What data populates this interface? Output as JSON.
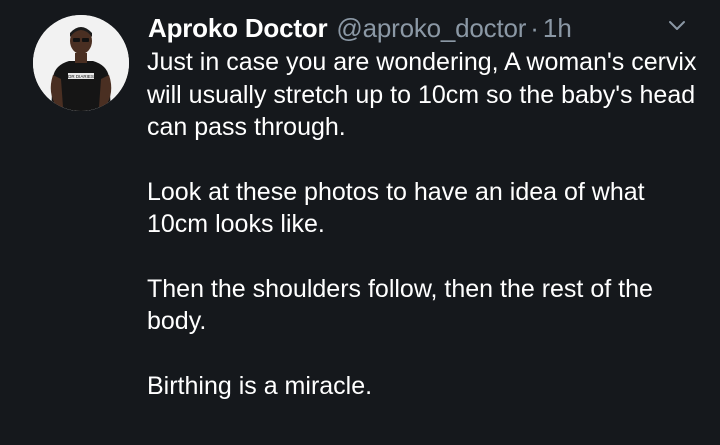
{
  "tweet": {
    "author": {
      "display_name": "Aproko Doctor",
      "handle": "@aproko_doctor",
      "separator": "·",
      "time": "1h",
      "avatar_shirt_text": "DR DIARIES"
    },
    "paragraphs": [
      "Just in case you are wondering, A woman's cervix will usually stretch up to 10cm so the baby's head can pass through.",
      "Look at these photos to have an idea of what 10cm looks like.",
      "Then the shoulders follow, then the rest of the body.",
      "Birthing is a miracle."
    ]
  },
  "colors": {
    "background": "#15181c",
    "text": "#ffffff",
    "secondary_text": "#8b98a5"
  },
  "icons": {
    "more": "chevron-down-icon",
    "avatar": "avatar"
  }
}
